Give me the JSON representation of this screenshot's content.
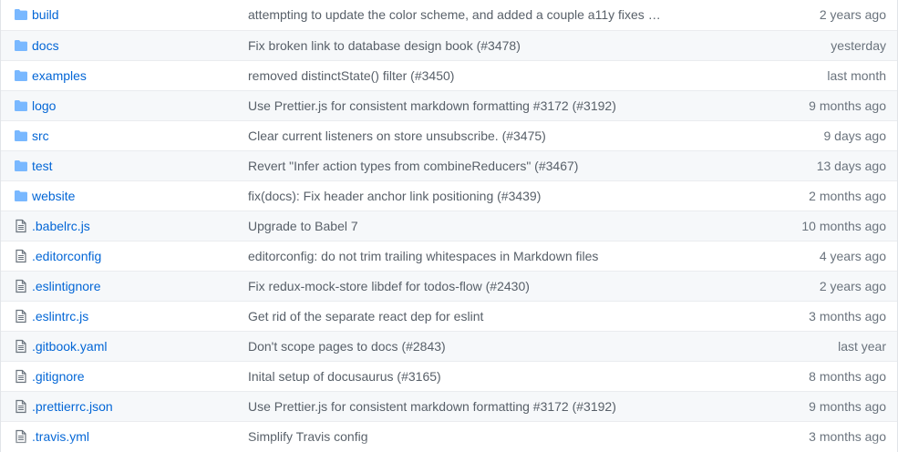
{
  "files": [
    {
      "type": "dir",
      "icon": "folder-icon",
      "name": "build",
      "message": "attempting to update the color scheme, and added a couple a11y fixes …",
      "age": "2 years ago"
    },
    {
      "type": "dir",
      "icon": "folder-icon",
      "name": "docs",
      "message": "Fix broken link to database design book (#3478)",
      "age": "yesterday"
    },
    {
      "type": "dir",
      "icon": "folder-icon",
      "name": "examples",
      "message": "removed distinctState() filter (#3450)",
      "age": "last month"
    },
    {
      "type": "dir",
      "icon": "folder-icon",
      "name": "logo",
      "message": "Use Prettier.js for consistent markdown formatting #3172 (#3192)",
      "age": "9 months ago"
    },
    {
      "type": "dir",
      "icon": "folder-icon",
      "name": "src",
      "message": "Clear current listeners on store unsubscribe. (#3475)",
      "age": "9 days ago"
    },
    {
      "type": "dir",
      "icon": "folder-icon",
      "name": "test",
      "message": "Revert \"Infer action types from combineReducers\" (#3467)",
      "age": "13 days ago"
    },
    {
      "type": "dir",
      "icon": "folder-icon",
      "name": "website",
      "message": "fix(docs): Fix header anchor link positioning (#3439)",
      "age": "2 months ago"
    },
    {
      "type": "file",
      "icon": "file-text-icon",
      "name": ".babelrc.js",
      "message": "Upgrade to Babel 7",
      "age": "10 months ago"
    },
    {
      "type": "file",
      "icon": "file-text-icon",
      "name": ".editorconfig",
      "message": "editorconfig: do not trim trailing whitespaces in Markdown files",
      "age": "4 years ago"
    },
    {
      "type": "file",
      "icon": "file-text-icon",
      "name": ".eslintignore",
      "message": "Fix redux-mock-store libdef for todos-flow (#2430)",
      "age": "2 years ago"
    },
    {
      "type": "file",
      "icon": "file-text-icon",
      "name": ".eslintrc.js",
      "message": "Get rid of the separate react dep for eslint",
      "age": "3 months ago"
    },
    {
      "type": "file",
      "icon": "file-text-icon",
      "name": ".gitbook.yaml",
      "message": "Don't scope pages to docs (#2843)",
      "age": "last year"
    },
    {
      "type": "file",
      "icon": "file-text-icon",
      "name": ".gitignore",
      "message": "Inital setup of docusaurus (#3165)",
      "age": "8 months ago"
    },
    {
      "type": "file",
      "icon": "file-text-icon",
      "name": ".prettierrc.json",
      "message": "Use Prettier.js for consistent markdown formatting #3172 (#3192)",
      "age": "9 months ago"
    },
    {
      "type": "file",
      "icon": "file-text-icon",
      "name": ".travis.yml",
      "message": "Simplify Travis config",
      "age": "3 months ago"
    }
  ],
  "colors": {
    "link": "#0366d6",
    "message": "#586069",
    "age": "#6a737d",
    "folder_icon": "#79b8ff",
    "file_icon": "#6a737d",
    "row_alt_bg": "#f6f8fa",
    "border": "#eaecef"
  }
}
